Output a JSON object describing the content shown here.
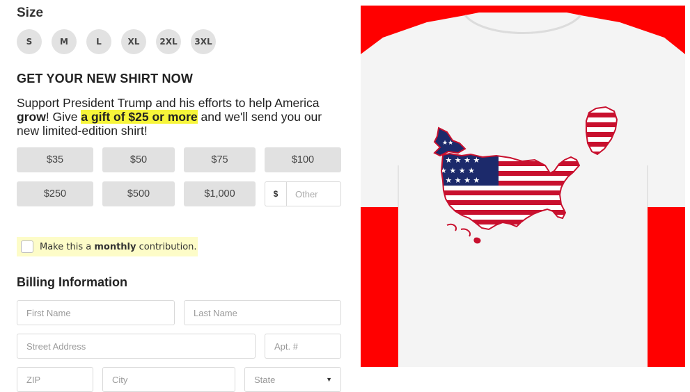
{
  "size": {
    "heading": "Size",
    "options": [
      "S",
      "M",
      "L",
      "XL",
      "2XL",
      "3XL"
    ]
  },
  "offer": {
    "heading": "GET YOUR NEW SHIRT NOW",
    "text_1": "Support President Trump and his efforts to help America ",
    "bold_1": "grow",
    "text_2": "! Give ",
    "highlight": "a gift of $25 or more",
    "text_3": " and we'll send you our new limited-edition shirt!"
  },
  "amounts": [
    "$35",
    "$50",
    "$75",
    "$100",
    "$250",
    "$500",
    "$1,000"
  ],
  "other": {
    "prefix": "$",
    "placeholder": "Other"
  },
  "monthly": {
    "text_1": "Make this a ",
    "bold": "monthly",
    "text_2": " contribution."
  },
  "billing": {
    "heading": "Billing Information",
    "first_name": "First Name",
    "last_name": "Last Name",
    "street": "Street Address",
    "apt": "Apt. #",
    "zip": "ZIP",
    "city": "City",
    "state": "State"
  },
  "colors": {
    "shirt_background": "#ff0000",
    "highlight": "#f7f53a",
    "monthly_background": "#fdfcc8",
    "flag_red": "#c8102e",
    "flag_blue": "#1c2a6b"
  },
  "icons": {
    "state_dropdown": "chevron-down-icon"
  }
}
